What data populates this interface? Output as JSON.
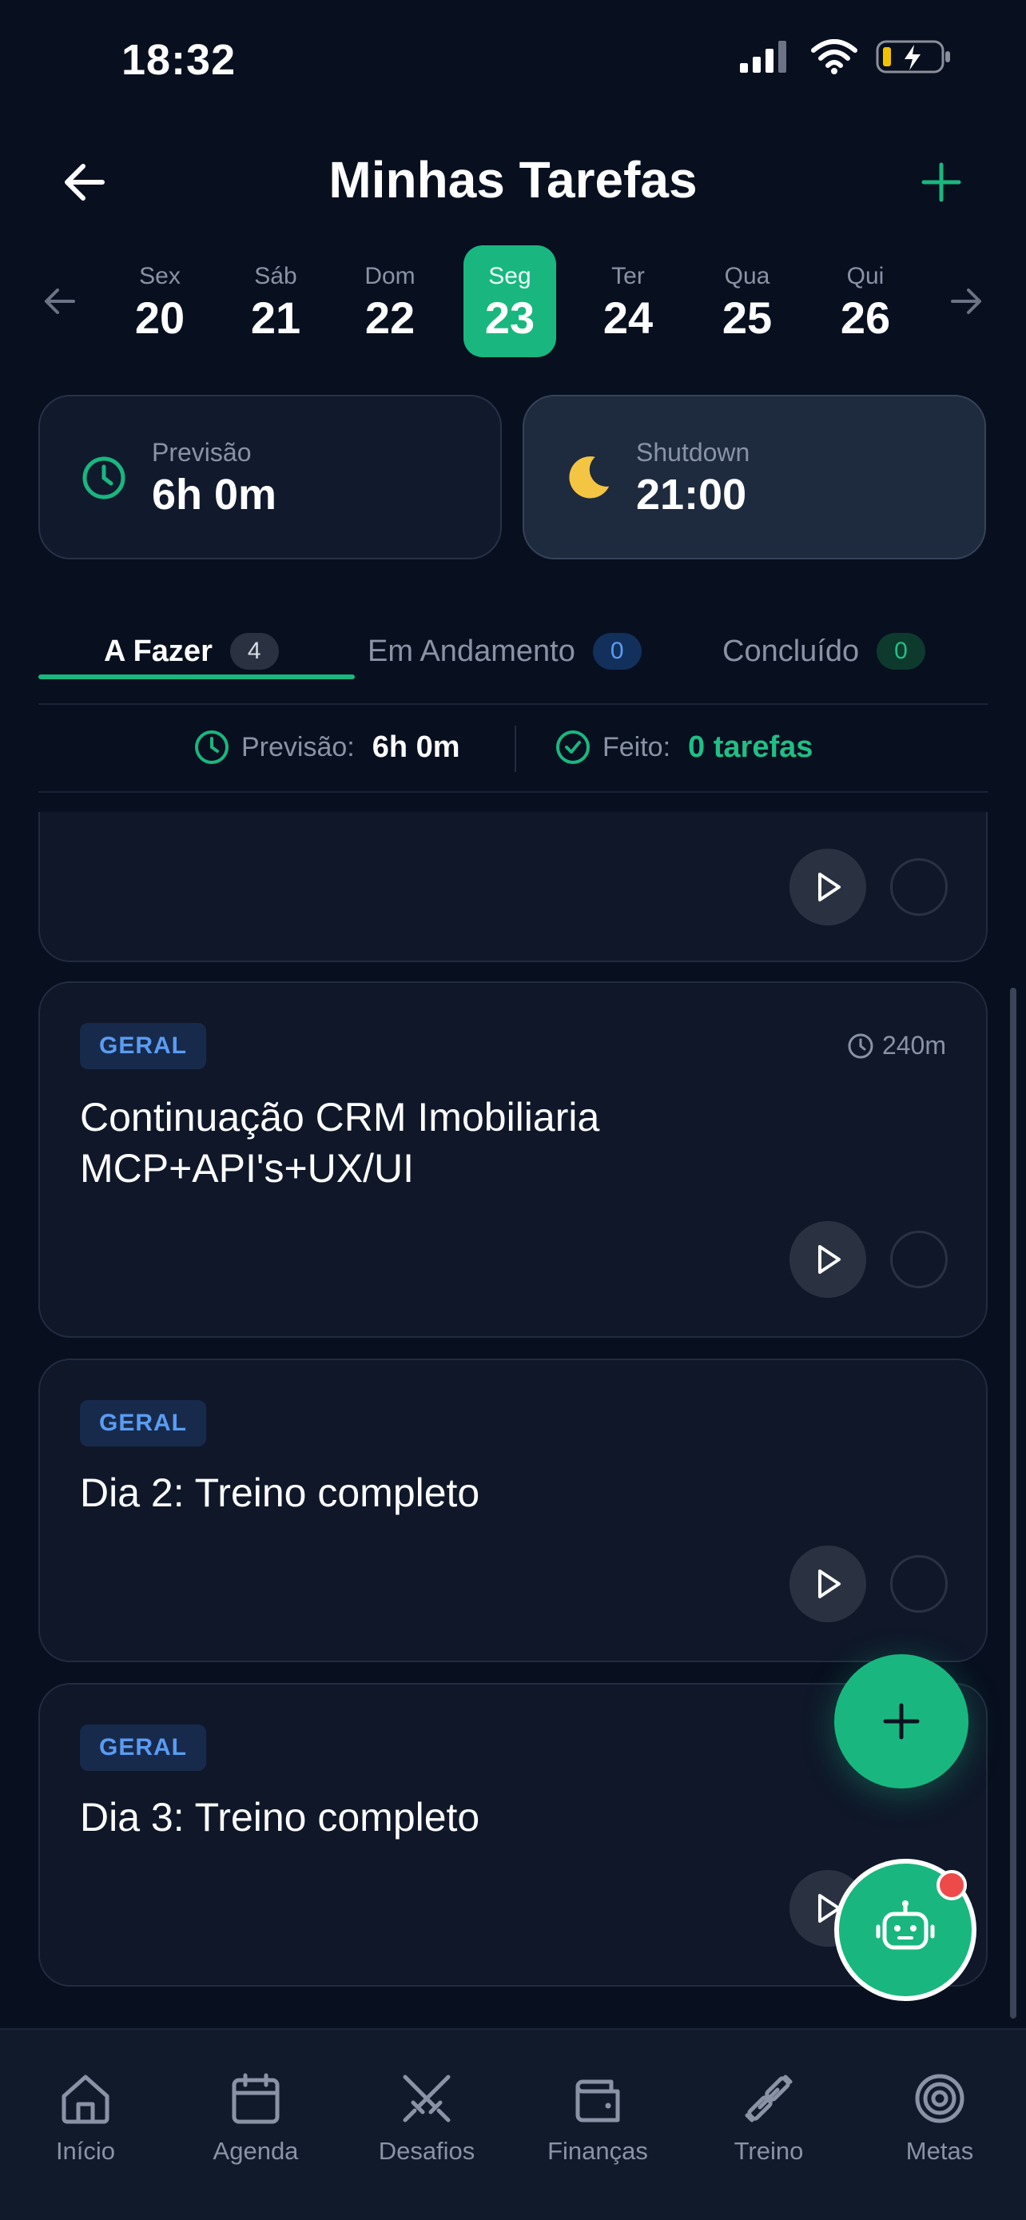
{
  "status_bar": {
    "time": "18:32"
  },
  "header": {
    "title": "Minhas Tarefas"
  },
  "dates": {
    "days": [
      {
        "name": "Sex",
        "num": "20"
      },
      {
        "name": "Sáb",
        "num": "21"
      },
      {
        "name": "Dom",
        "num": "22"
      },
      {
        "name": "Seg",
        "num": "23"
      },
      {
        "name": "Ter",
        "num": "24"
      },
      {
        "name": "Qua",
        "num": "25"
      },
      {
        "name": "Qui",
        "num": "26"
      }
    ],
    "selected": "Seg 23"
  },
  "cards": {
    "forecast": {
      "label": "Previsão",
      "value": "6h 0m"
    },
    "shutdown": {
      "label": "Shutdown",
      "value": "21:00"
    }
  },
  "tabs": [
    {
      "label": "A Fazer",
      "count": "4"
    },
    {
      "label": "Em Andamento",
      "count": "0"
    },
    {
      "label": "Concluído",
      "count": "0"
    }
  ],
  "summary": {
    "forecast_label": "Previsão:",
    "forecast_value": "6h 0m",
    "done_label": "Feito:",
    "done_value": "0 tarefas"
  },
  "tasks": [
    {
      "badge": "",
      "title": "",
      "duration": ""
    },
    {
      "badge": "GERAL",
      "title_line1": "Continuação CRM Imobiliaria",
      "title_line2": "MCP+API's+UX/UI",
      "duration": "240m"
    },
    {
      "badge": "GERAL",
      "title": "Dia 2: Treino completo"
    },
    {
      "badge": "GERAL",
      "title": "Dia 3: Treino completo"
    }
  ],
  "nav": [
    {
      "label": "Início",
      "icon": "home-icon"
    },
    {
      "label": "Agenda",
      "icon": "calendar-icon"
    },
    {
      "label": "Desafios",
      "icon": "swords-icon"
    },
    {
      "label": "Finanças",
      "icon": "wallet-icon"
    },
    {
      "label": "Treino",
      "icon": "dumbbell-icon"
    },
    {
      "label": "Metas",
      "icon": "target-icon"
    }
  ],
  "colors": {
    "background": "#080f1f",
    "accent": "#19b77f",
    "badge_blue": "#5b9cf2",
    "notification": "#ee4a4a"
  }
}
